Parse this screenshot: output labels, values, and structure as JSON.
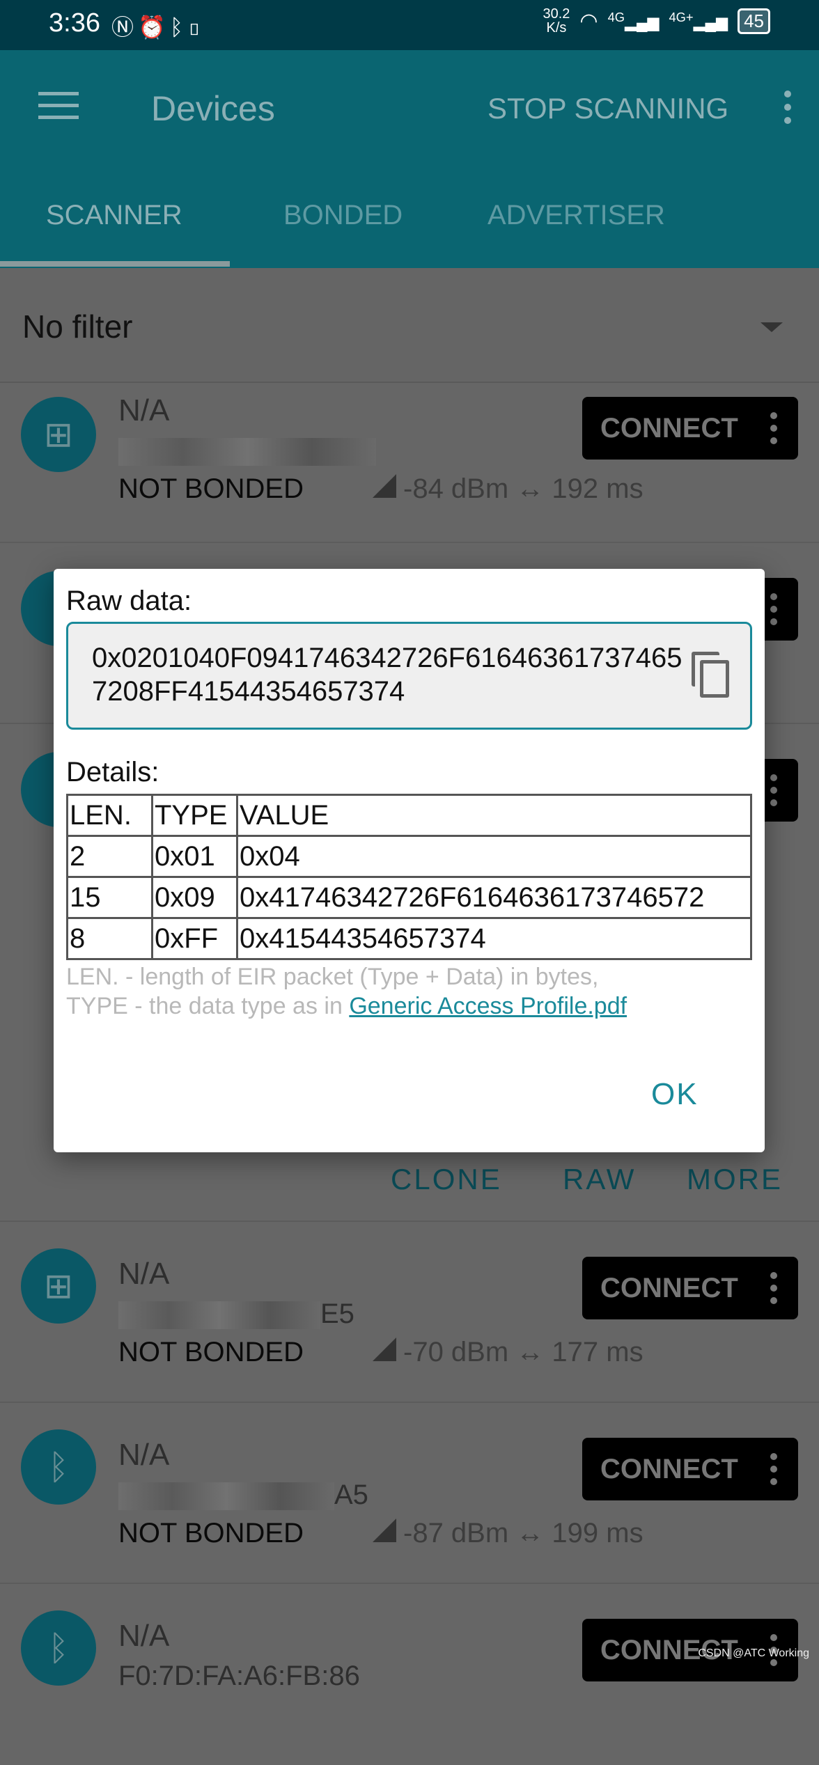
{
  "status_bar": {
    "time": "3:36",
    "left_icons": [
      "nfc-icon",
      "alarm-icon",
      "bluetooth-icon",
      "vibrate-icon"
    ],
    "speed_value": "30.2",
    "speed_unit": "K/s",
    "network_1": "4G",
    "network_2": "4G+",
    "battery": "45"
  },
  "app_bar": {
    "title": "Devices",
    "action": "STOP SCANNING",
    "tabs": [
      {
        "label": "SCANNER",
        "active": true
      },
      {
        "label": "BONDED",
        "active": false
      },
      {
        "label": "ADVERTISER",
        "active": false
      }
    ]
  },
  "filter": {
    "value": "No filter"
  },
  "devices": [
    {
      "name": "N/A",
      "address_suffix": "",
      "bond": "NOT BONDED",
      "rssi": "-84 dBm",
      "interval": "192 ms",
      "icon": "windows-icon",
      "connect": "CONNECT"
    },
    {
      "name": "N/A",
      "address_suffix": "E5",
      "bond": "NOT BONDED",
      "rssi": "-70 dBm",
      "interval": "177 ms",
      "icon": "windows-icon",
      "connect": "CONNECT"
    },
    {
      "name": "N/A",
      "address_suffix": "A5",
      "bond": "NOT BONDED",
      "rssi": "-87 dBm",
      "interval": "199 ms",
      "icon": "bluetooth-icon",
      "connect": "CONNECT"
    },
    {
      "name": "N/A",
      "address": "F0:7D:FA:A6:FB:86",
      "icon": "bluetooth-icon",
      "connect": "CONNECT"
    }
  ],
  "expanded_actions": {
    "clone": "CLONE",
    "raw": "RAW",
    "more": "MORE"
  },
  "dialog": {
    "raw_label": "Raw data:",
    "raw_value": "0x0201040F0941746342726F616463617374657208FF41544354657374",
    "details_label": "Details:",
    "headers": [
      "LEN.",
      "TYPE",
      "VALUE"
    ],
    "rows": [
      [
        "2",
        "0x01",
        "0x04"
      ],
      [
        "15",
        "0x09",
        "0x41746342726F6164636173746572"
      ],
      [
        "8",
        "0xFF",
        "0x41544354657374"
      ]
    ],
    "note_line1": "LEN. - length of EIR packet (Type + Data) in bytes,",
    "note_line2": "TYPE - the data type as in ",
    "note_link": "Generic Access Profile.pdf",
    "ok": "OK"
  },
  "watermark": "CSDN @ATC Working"
}
